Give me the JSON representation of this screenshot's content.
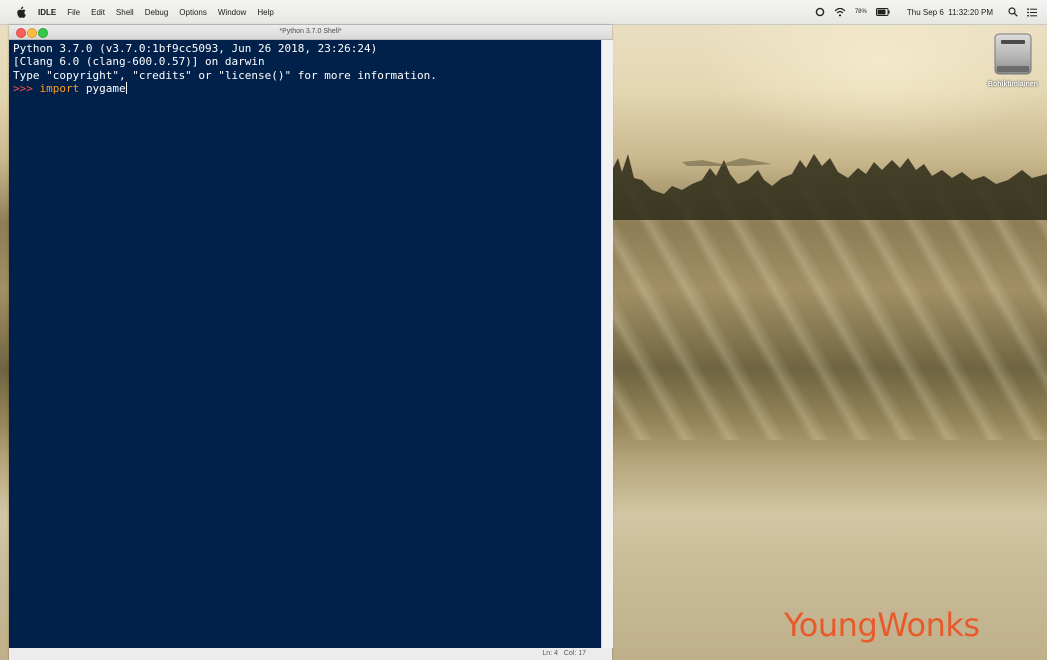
{
  "menubar": {
    "items": [
      "IDLE",
      "File",
      "Edit",
      "Shell",
      "Debug",
      "Options",
      "Window",
      "Help"
    ],
    "battery": "78%",
    "clock": "Thu Sep 6  11:32:20 PM",
    "icons": [
      "apple-icon",
      "sync-icon",
      "wifi-icon",
      "battery-icon",
      "search-icon",
      "list-icon"
    ]
  },
  "window": {
    "title": "*Python 3.7.0 Shell*",
    "lines": [
      "Python 3.7.0 (v3.7.0:1bf9cc5093, Jun 26 2018, 23:26:24)",
      "[Clang 6.0 (clang-600.0.57)] on darwin",
      "Type \"copyright\", \"credits\" or \"license()\" for more information."
    ],
    "prompt": ">>> ",
    "input_keyword": "import",
    "input_rest": " pygame",
    "status": "Ln: 4   Col: 17"
  },
  "desktop": {
    "drive_label": "Bohiktimlainen",
    "watermark": "YoungWonks"
  },
  "colors": {
    "shell_bg": "#01204a",
    "prompt": "#ff4c4c",
    "keyword": "#ff9c1a",
    "watermark": "#e85a2b"
  }
}
